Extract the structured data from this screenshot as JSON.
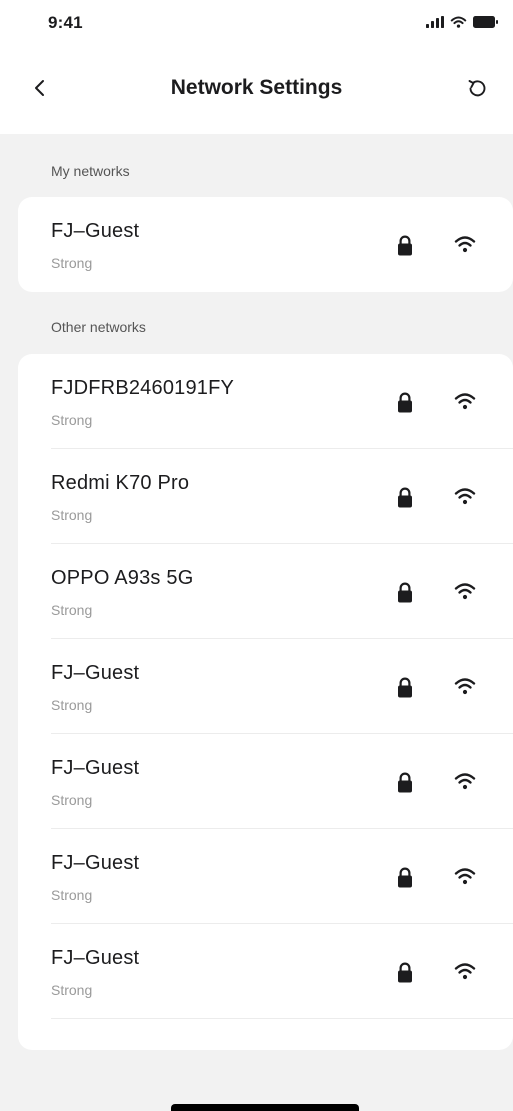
{
  "status_bar": {
    "time": "9:41",
    "icons": [
      "cellular-signal-icon",
      "wifi-status-icon",
      "battery-icon"
    ]
  },
  "header": {
    "title": "Network Settings",
    "back_icon": "chevron-left-icon",
    "refresh_icon": "refresh-icon"
  },
  "my_networks": {
    "label": "My networks",
    "items": [
      {
        "name": "FJ–Guest",
        "strength": "Strong",
        "secured": true
      }
    ]
  },
  "other_networks": {
    "label": "Other networks",
    "items": [
      {
        "name": "FJDFRB2460191FY",
        "strength": "Strong",
        "secured": true
      },
      {
        "name": "Redmi K70 Pro",
        "strength": "Strong",
        "secured": true
      },
      {
        "name": "OPPO A93s 5G",
        "strength": "Strong",
        "secured": true
      },
      {
        "name": "FJ–Guest",
        "strength": "Strong",
        "secured": true
      },
      {
        "name": "FJ–Guest",
        "strength": "Strong",
        "secured": true
      },
      {
        "name": "FJ–Guest",
        "strength": "Strong",
        "secured": true
      },
      {
        "name": "FJ–Guest",
        "strength": "Strong",
        "secured": true
      }
    ]
  },
  "colors": {
    "background": "#f2f2f2",
    "card": "#ffffff",
    "text_primary": "#1c1c1e",
    "text_secondary": "#9a9a9a",
    "icon": "#1c1c1e"
  }
}
